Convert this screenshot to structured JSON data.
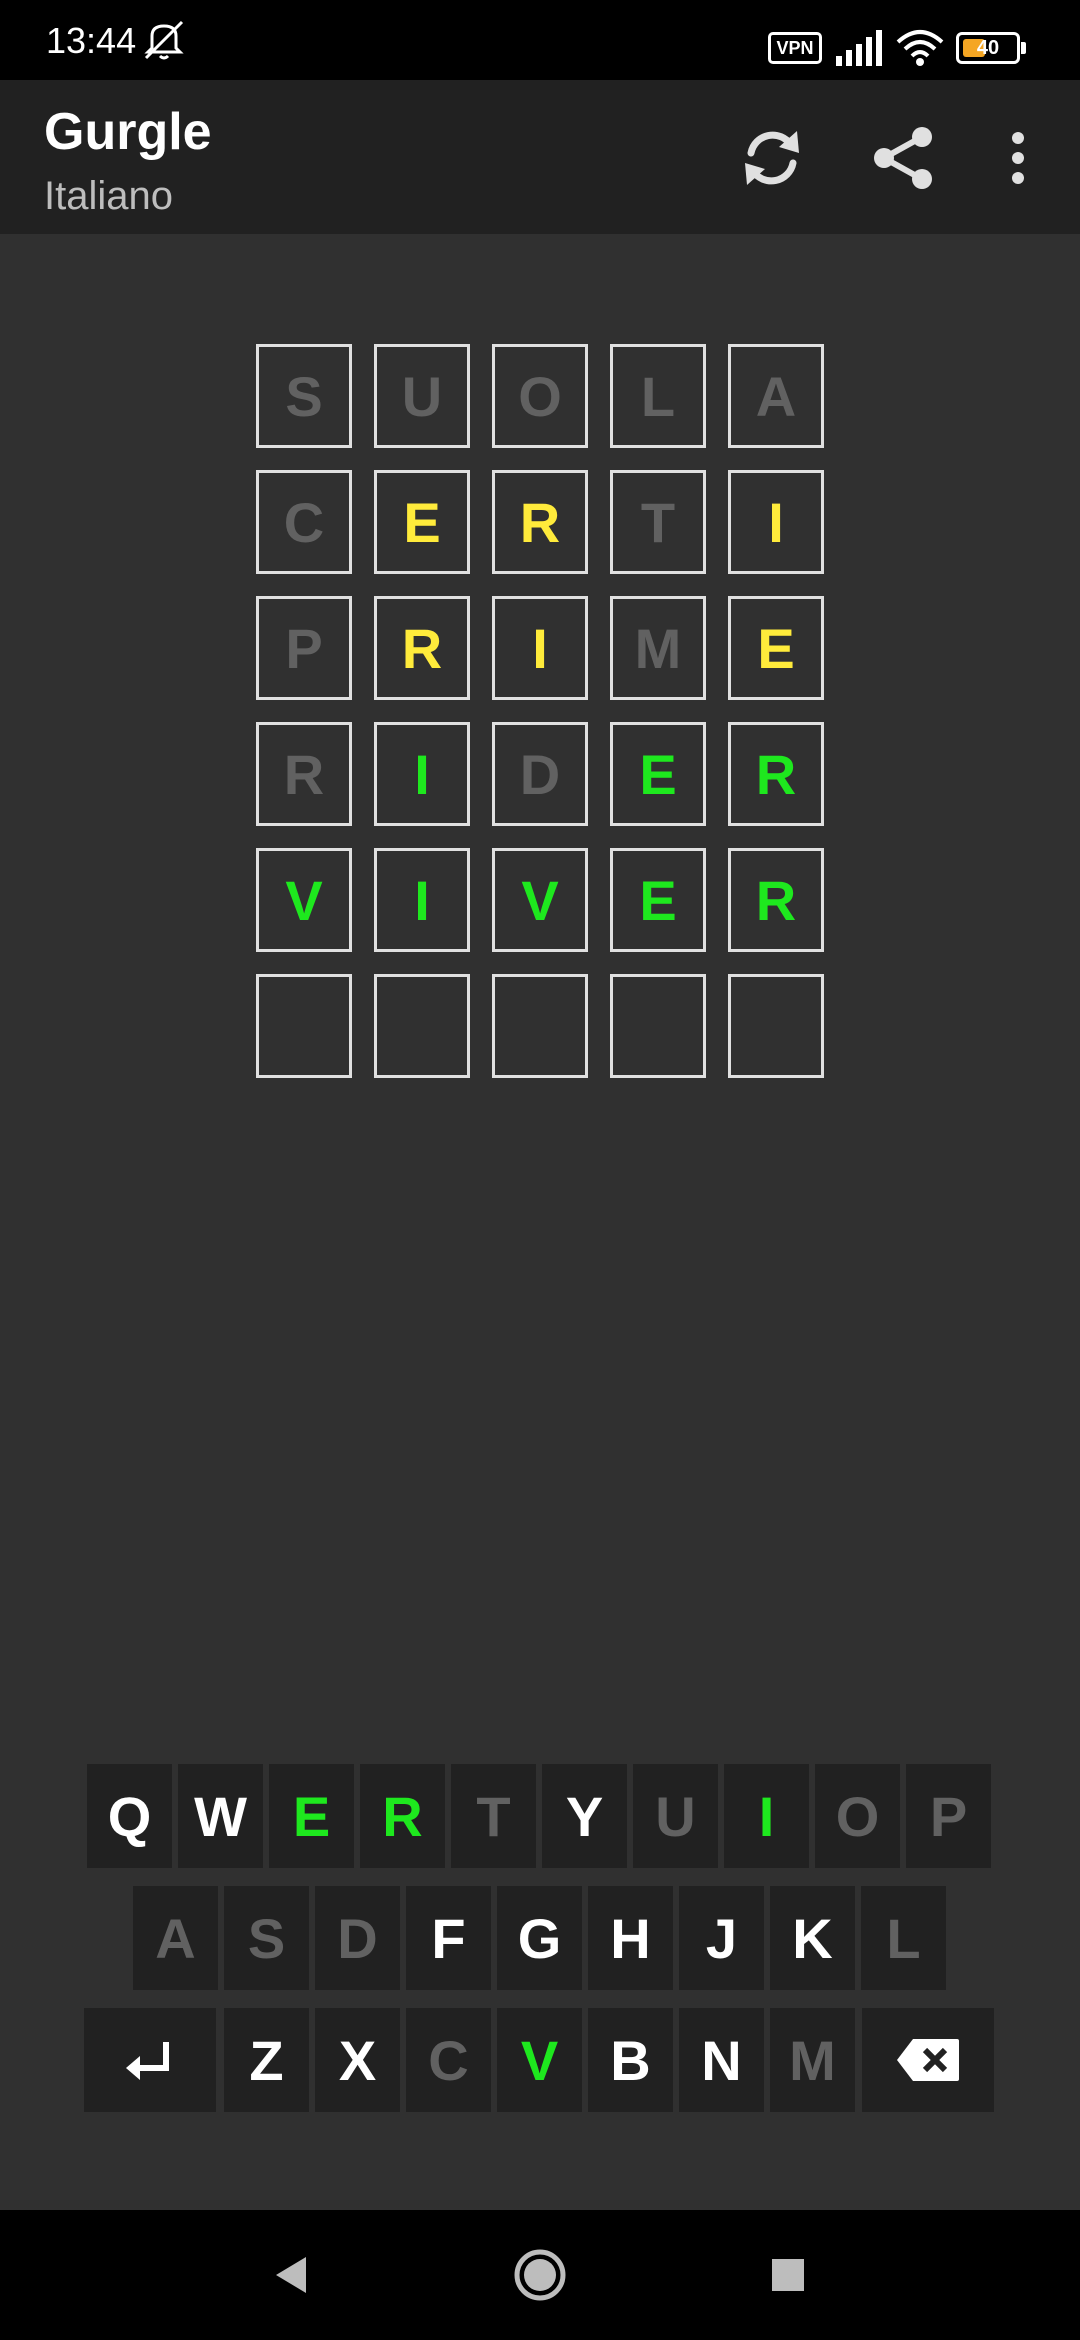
{
  "status_bar": {
    "time": "13:44",
    "vpn_label": "VPN",
    "battery_level": "40",
    "icons": [
      "mute-icon",
      "signal-icon",
      "wifi-icon",
      "battery-icon"
    ]
  },
  "app_bar": {
    "title": "Gurgle",
    "subtitle": "Italiano",
    "actions": [
      "refresh-icon",
      "share-icon",
      "more-vert-icon"
    ]
  },
  "colors": {
    "background": "#303030",
    "bar": "#212121",
    "absent": "#616161",
    "present": "#ffeb3b",
    "correct": "#1ee81e",
    "default_key": "#ffffff"
  },
  "board": {
    "rows": [
      [
        {
          "l": "S",
          "s": "absent"
        },
        {
          "l": "U",
          "s": "absent"
        },
        {
          "l": "O",
          "s": "absent"
        },
        {
          "l": "L",
          "s": "absent"
        },
        {
          "l": "A",
          "s": "absent"
        }
      ],
      [
        {
          "l": "C",
          "s": "absent"
        },
        {
          "l": "E",
          "s": "present"
        },
        {
          "l": "R",
          "s": "present"
        },
        {
          "l": "T",
          "s": "absent"
        },
        {
          "l": "I",
          "s": "present"
        }
      ],
      [
        {
          "l": "P",
          "s": "absent"
        },
        {
          "l": "R",
          "s": "present"
        },
        {
          "l": "I",
          "s": "present"
        },
        {
          "l": "M",
          "s": "absent"
        },
        {
          "l": "E",
          "s": "present"
        }
      ],
      [
        {
          "l": "R",
          "s": "absent"
        },
        {
          "l": "I",
          "s": "correct"
        },
        {
          "l": "D",
          "s": "absent"
        },
        {
          "l": "E",
          "s": "correct"
        },
        {
          "l": "R",
          "s": "correct"
        }
      ],
      [
        {
          "l": "V",
          "s": "correct"
        },
        {
          "l": "I",
          "s": "correct"
        },
        {
          "l": "V",
          "s": "correct"
        },
        {
          "l": "E",
          "s": "correct"
        },
        {
          "l": "R",
          "s": "correct"
        }
      ],
      [
        {
          "l": "",
          "s": "empty"
        },
        {
          "l": "",
          "s": "empty"
        },
        {
          "l": "",
          "s": "empty"
        },
        {
          "l": "",
          "s": "empty"
        },
        {
          "l": "",
          "s": "empty"
        }
      ]
    ]
  },
  "keyboard": {
    "rows": [
      [
        {
          "l": "Q",
          "s": "key"
        },
        {
          "l": "W",
          "s": "key"
        },
        {
          "l": "E",
          "s": "correct"
        },
        {
          "l": "R",
          "s": "correct"
        },
        {
          "l": "T",
          "s": "absent"
        },
        {
          "l": "Y",
          "s": "key"
        },
        {
          "l": "U",
          "s": "absent"
        },
        {
          "l": "I",
          "s": "correct"
        },
        {
          "l": "O",
          "s": "absent"
        },
        {
          "l": "P",
          "s": "absent"
        }
      ],
      [
        {
          "l": "A",
          "s": "absent"
        },
        {
          "l": "S",
          "s": "absent"
        },
        {
          "l": "D",
          "s": "absent"
        },
        {
          "l": "F",
          "s": "key"
        },
        {
          "l": "G",
          "s": "key"
        },
        {
          "l": "H",
          "s": "key"
        },
        {
          "l": "J",
          "s": "key"
        },
        {
          "l": "K",
          "s": "key"
        },
        {
          "l": "L",
          "s": "absent"
        }
      ],
      [
        {
          "l": "Z",
          "s": "key"
        },
        {
          "l": "X",
          "s": "key"
        },
        {
          "l": "C",
          "s": "absent"
        },
        {
          "l": "V",
          "s": "correct"
        },
        {
          "l": "B",
          "s": "key"
        },
        {
          "l": "N",
          "s": "key"
        },
        {
          "l": "M",
          "s": "absent"
        }
      ]
    ],
    "enter_icon": "enter-icon",
    "backspace_icon": "backspace-icon"
  },
  "nav_bar": {
    "icons": [
      "back-icon",
      "home-icon",
      "recents-icon"
    ]
  }
}
